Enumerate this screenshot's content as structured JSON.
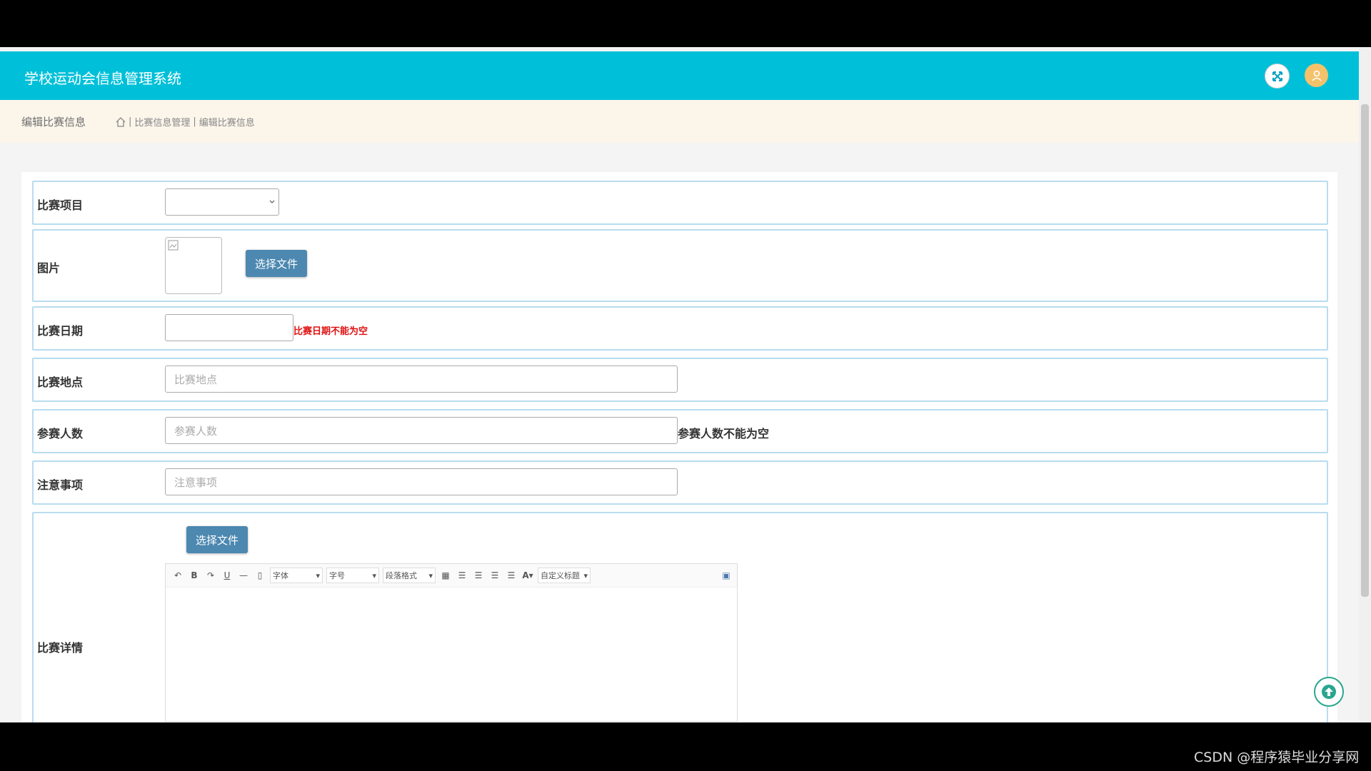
{
  "header": {
    "title": "学校运动会信息管理系统"
  },
  "breadcrumb": {
    "page_title": "编辑比赛信息",
    "path": "比赛信息管理",
    "current": "编辑比赛信息"
  },
  "form": {
    "project": {
      "label": "比赛项目",
      "value": ""
    },
    "image": {
      "label": "图片",
      "button": "选择文件"
    },
    "date": {
      "label": "比赛日期",
      "value": "",
      "error": "比赛日期不能为空"
    },
    "location": {
      "label": "比赛地点",
      "placeholder": "比赛地点"
    },
    "participants": {
      "label": "参赛人数",
      "placeholder": "参赛人数",
      "error": "参赛人数不能为空"
    },
    "notes": {
      "label": "注意事项",
      "placeholder": "注意事项"
    },
    "details": {
      "label": "比赛详情",
      "button": "选择文件",
      "toolbar": {
        "font": "字体",
        "size": "字号",
        "paragraph": "段落格式",
        "custom_title": "自定义标题"
      }
    }
  },
  "watermark": "CSDN @程序猿毕业分享网",
  "colors": {
    "header": "#00c0d9",
    "breadcrumb_bg": "#fbf5ea",
    "button": "#4c88b0",
    "error": "#e01010",
    "row_border": "#b8dcef"
  },
  "icons": [
    "fullscreen-icon",
    "user-avatar-icon",
    "home-icon",
    "back-to-top-icon",
    "broken-image-icon"
  ]
}
